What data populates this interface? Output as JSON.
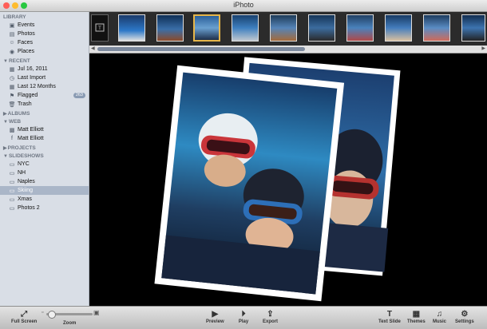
{
  "window": {
    "title": "iPhoto"
  },
  "sidebar": {
    "library": {
      "header": "LIBRARY",
      "items": [
        "Events",
        "Photos",
        "Faces",
        "Places"
      ]
    },
    "recent": {
      "header": "RECENT",
      "items": [
        "Jul 16, 2011",
        "Last Import",
        "Last 12 Months",
        "Flagged",
        "Trash"
      ],
      "flagged_badge": "263"
    },
    "albums": {
      "header": "ALBUMS"
    },
    "web": {
      "header": "WEB",
      "items": [
        "Matt Elliott",
        "Matt Elliott"
      ]
    },
    "projects": {
      "header": "PROJECTS"
    },
    "slideshows": {
      "header": "SLIDESHOWS",
      "items": [
        "NYC",
        "NH",
        "Naples",
        "Skiing",
        "Xmas",
        "Photos 2"
      ],
      "selected": "Skiing"
    }
  },
  "toolbar": {
    "full_screen": "Full Screen",
    "zoom": "Zoom",
    "preview": "Preview",
    "play": "Play",
    "export": "Export",
    "text_slide": "Text Slide",
    "themes": "Themes",
    "music": "Music",
    "settings": "Settings"
  },
  "colors": {
    "accent": "#e6b64a",
    "sidebar_bg": "#d9dee6",
    "selection": "#aab6c8"
  }
}
